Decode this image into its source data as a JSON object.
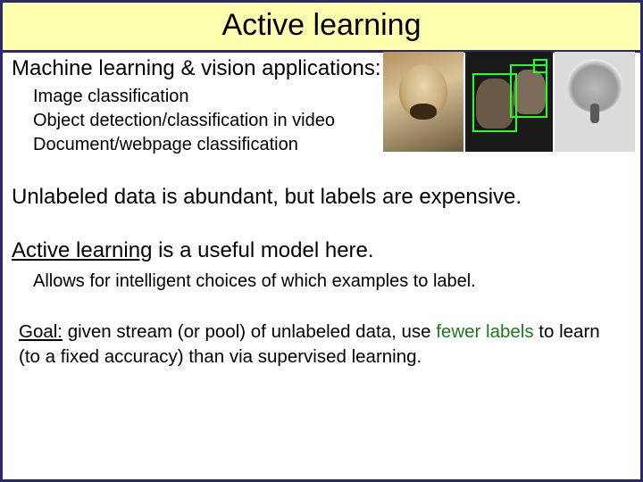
{
  "title": "Active learning",
  "section1": {
    "heading": "Machine learning & vision applications:",
    "items": [
      "Image classification",
      "Object detection/classification in video",
      "Document/webpage classification"
    ]
  },
  "para1": "Unlabeled data is abundant, but labels are expensive.",
  "para2_pre": "Active learning",
  "para2_post": " is a useful model here.",
  "para2_sub": "Allows for intelligent choices of which examples to label.",
  "goal_label": "Goal:",
  "goal_a": " given stream (or pool) of unlabeled data, use ",
  "goal_green": "fewer labels",
  "goal_b": " to learn (to a fixed accuracy) than via supervised learning.",
  "images": {
    "dog": "dog-photo",
    "video": "video-detection-photo",
    "einstein": "einstein-photo"
  }
}
